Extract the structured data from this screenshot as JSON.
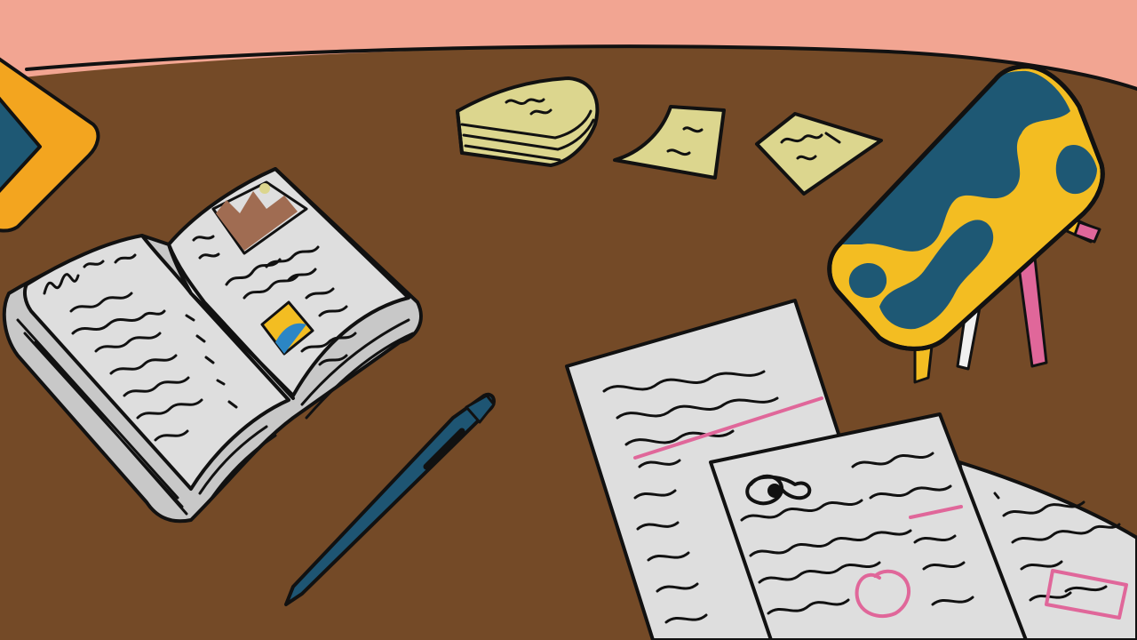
{
  "scene": {
    "description_free": true,
    "colors": {
      "wall": "#f2a592",
      "desk": "#744a27",
      "paper": "#dedede",
      "sticky_note": "#dcd68e",
      "pen_blue": "#1e5573",
      "pencil_case_yellow": "#f3bd22",
      "pencil_case_teal": "#1e5874",
      "highlight_pink": "#e0679a",
      "ink": "#111111"
    },
    "icons": [
      "open-book-icon",
      "pen-icon",
      "sticky-note-icon",
      "pencil-case-icon",
      "paper-sheet-icon",
      "tablet-icon"
    ]
  }
}
